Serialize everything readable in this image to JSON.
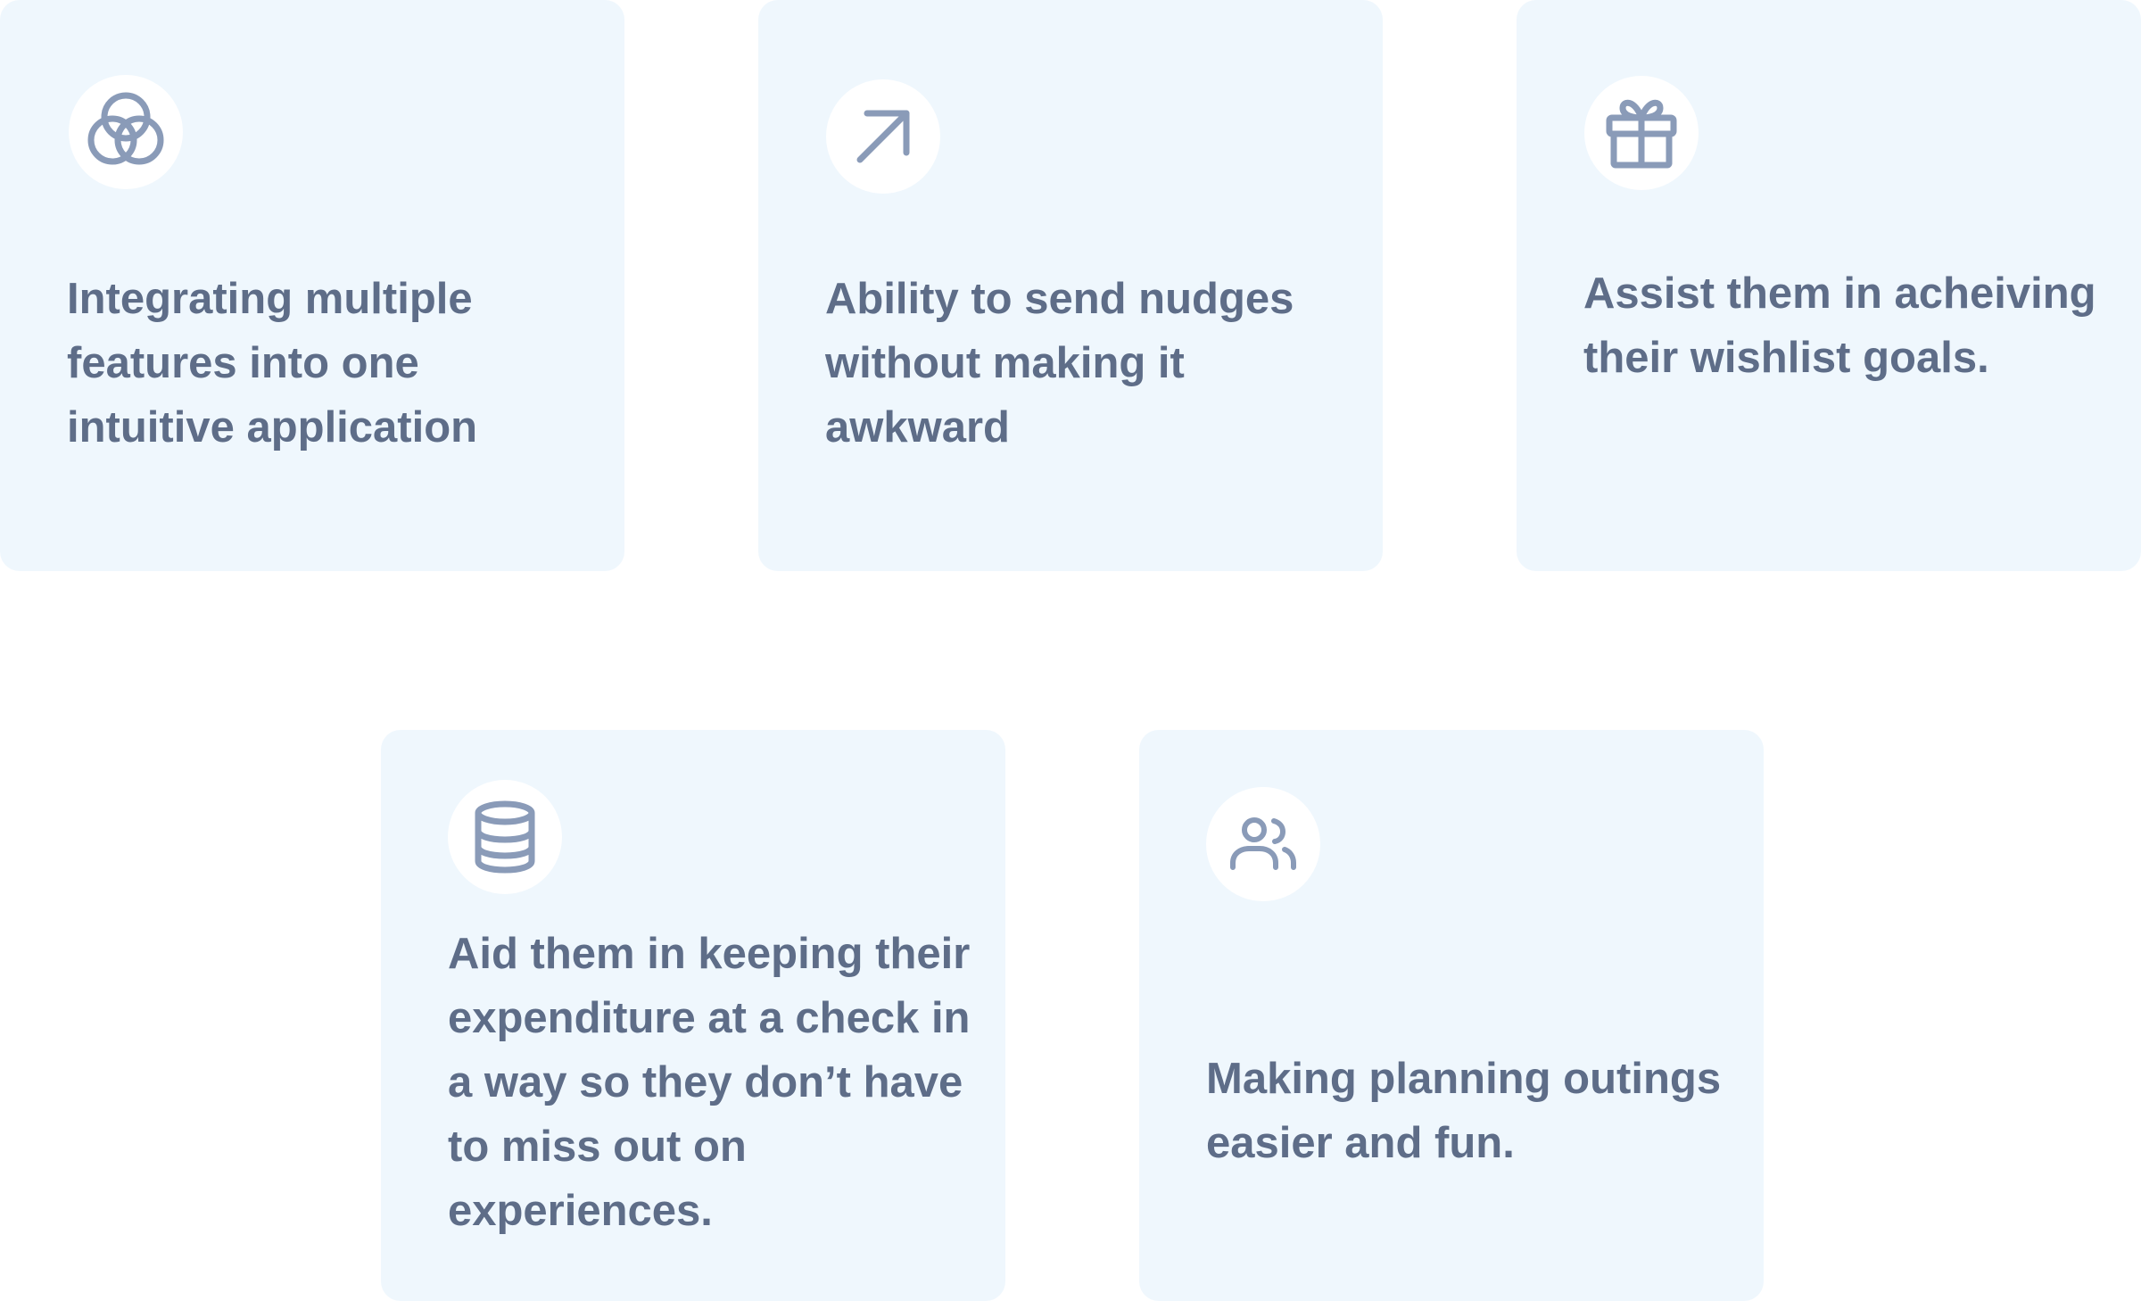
{
  "colors": {
    "card_background": "#eff7fd",
    "icon_background": "#ffffff",
    "icon_stroke": "#8a9bb8",
    "text": "#5e6d88",
    "page_background": "#ffffff"
  },
  "cards": [
    {
      "icon": "overlapping-circles-icon",
      "text": "Integrating multiple features into one intuitive application"
    },
    {
      "icon": "arrow-up-right-icon",
      "text": "Ability to send nudges without making it awkward"
    },
    {
      "icon": "gift-icon",
      "text": "Assist them in acheiving their wishlist goals."
    },
    {
      "icon": "database-icon",
      "text": "Aid them in keeping their expenditure at a check in a way so they don’t have to miss out on experiences."
    },
    {
      "icon": "users-icon",
      "text": "Making planning outings easier and fun."
    }
  ]
}
